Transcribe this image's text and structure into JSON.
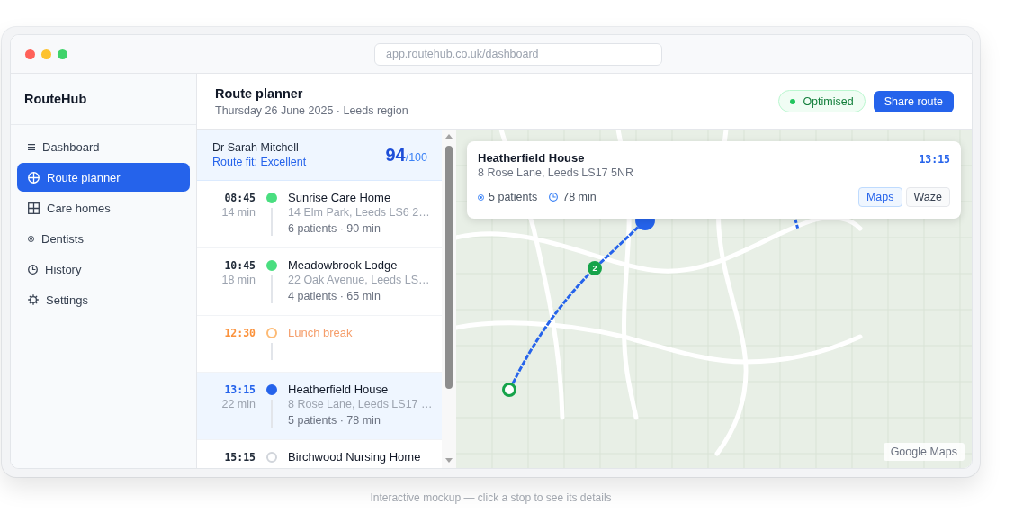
{
  "browser": {
    "url": "app.routehub.co.uk/dashboard"
  },
  "sidebar": {
    "brand": "RouteHub",
    "items": [
      {
        "label": "Dashboard",
        "selected": false
      },
      {
        "label": "Route planner",
        "selected": true
      },
      {
        "label": "Care homes",
        "selected": false
      },
      {
        "label": "Dentists",
        "selected": false
      },
      {
        "label": "History",
        "selected": false
      },
      {
        "label": "Settings",
        "selected": false
      }
    ]
  },
  "header": {
    "title": "Route planner",
    "subtitle": "Thursday 26 June 2025 · Leeds region",
    "status": "Optimised",
    "action": "Share route"
  },
  "schedule": {
    "doctor": "Dr Sarah Mitchell",
    "fit": "Route fit: Excellent",
    "score": "94",
    "score_max": "/100",
    "stops": [
      {
        "kind": "stop",
        "time": "08:45",
        "travel": "14 min",
        "name": "Sunrise Care Home",
        "address": "14 Elm Park, Leeds LS6 2…",
        "details": "6 patients · 90 min",
        "color": "#4ade80",
        "filled": true,
        "selected": false
      },
      {
        "kind": "stop",
        "time": "10:45",
        "travel": "18 min",
        "name": "Meadowbrook Lodge",
        "address": "22 Oak Avenue, Leeds LS…",
        "details": "4 patients · 65 min",
        "color": "#4ade80",
        "filled": true,
        "selected": false
      },
      {
        "kind": "break",
        "time": "12:30",
        "name": "Lunch break",
        "color": "#fdba74",
        "filled": false,
        "selected": false
      },
      {
        "kind": "stop",
        "time": "13:15",
        "travel": "22 min",
        "name": "Heatherfield House",
        "address": "8 Rose Lane, Leeds LS17 …",
        "details": "5 patients · 78 min",
        "color": "#2563eb",
        "filled": true,
        "selected": true
      },
      {
        "kind": "stop",
        "time": "15:15",
        "name": "Birchwood Nursing Home",
        "color": "#d1d5db",
        "filled": false,
        "selected": false
      }
    ]
  },
  "map": {
    "markers": [
      {
        "kind": "start",
        "color": "#16a34a",
        "selected": false
      },
      {
        "kind": "stop",
        "label": "2",
        "color": "#16a34a",
        "selected": false
      },
      {
        "kind": "stop",
        "color": "#2563eb",
        "selected": true
      }
    ],
    "card": {
      "title": "Heatherfield House",
      "address": "8 Rose Lane, Leeds LS17 5NR",
      "time": "13:15",
      "patients": "5 patients",
      "duration": "78 min",
      "buttons": [
        {
          "label": "Maps",
          "selected": true
        },
        {
          "label": "Waze",
          "selected": false
        }
      ]
    },
    "attribution": "Google Maps"
  },
  "caption": "Interactive mockup — click a stop to see its details"
}
